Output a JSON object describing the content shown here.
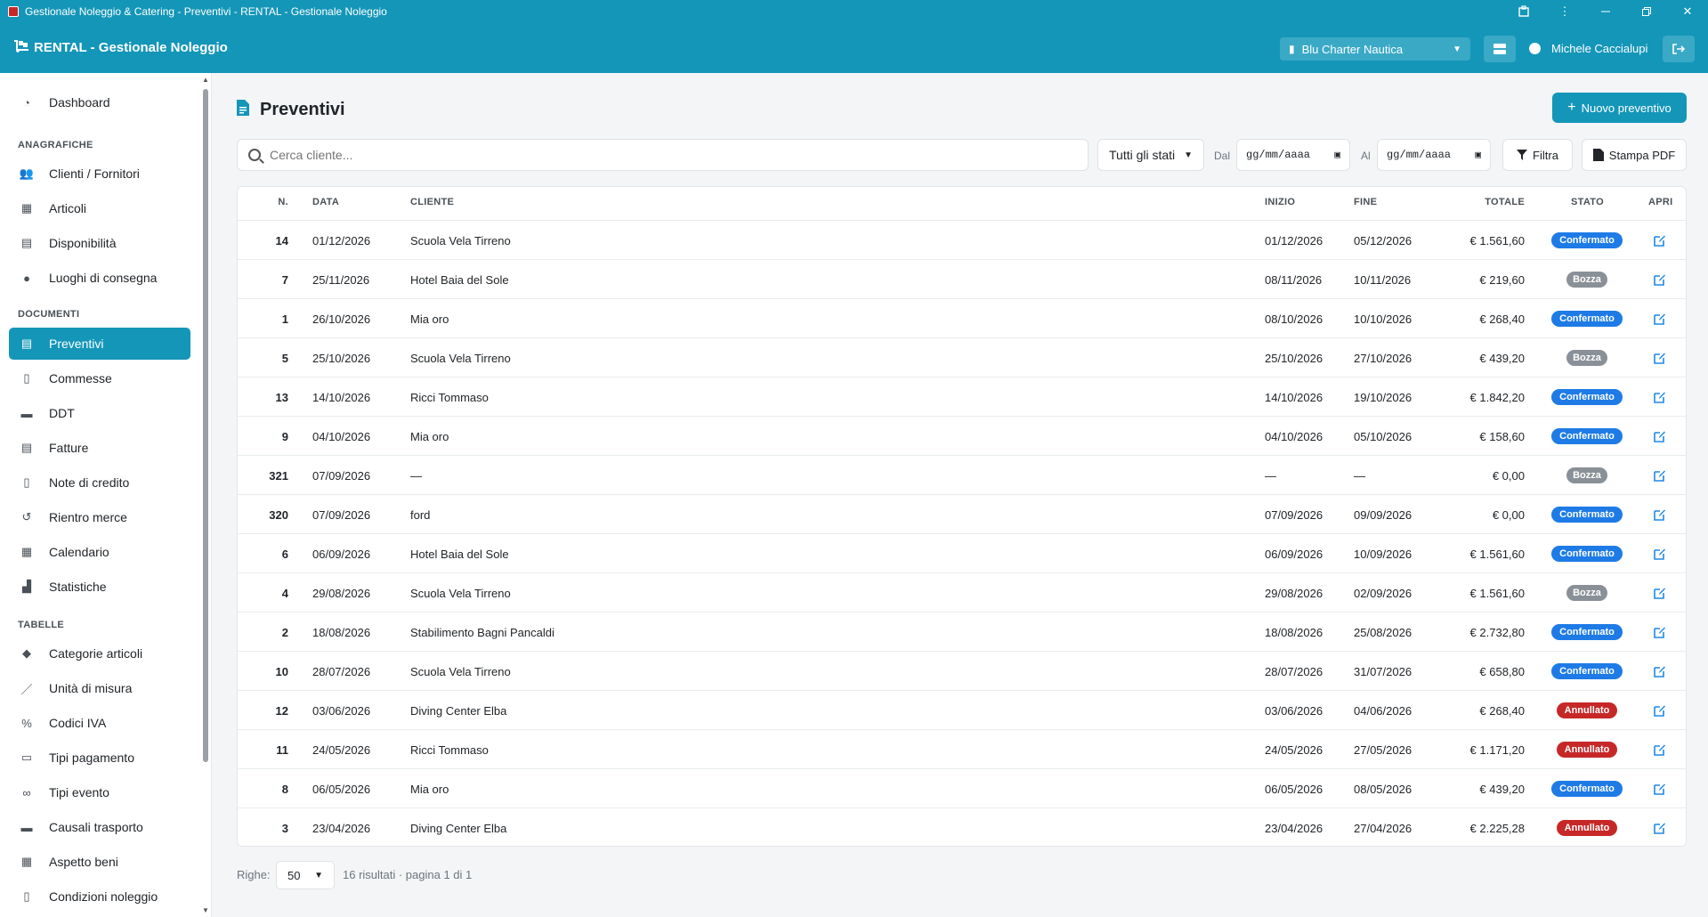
{
  "window": {
    "title": "Gestionale Noleggio & Catering - Preventivi - RENTAL - Gestionale Noleggio"
  },
  "header": {
    "brand": "RENTAL - Gestionale Noleggio",
    "company": "Blu Charter Nautica",
    "user": "Michele Caccialupi"
  },
  "sidebar": {
    "dashboard": "Dashboard",
    "sections": {
      "anagrafiche": "ANAGRAFICHE",
      "documenti": "DOCUMENTI",
      "tabelle": "TABELLE"
    },
    "items": [
      {
        "label": "Clienti / Fornitori",
        "icon": "users-icon"
      },
      {
        "label": "Articoli",
        "icon": "boxes-icon"
      },
      {
        "label": "Disponibilità",
        "icon": "warehouse-icon"
      },
      {
        "label": "Luoghi di consegna",
        "icon": "map-pin-icon"
      },
      {
        "label": "Preventivi",
        "icon": "file-invoice-icon",
        "active": true
      },
      {
        "label": "Commesse",
        "icon": "file-icon"
      },
      {
        "label": "DDT",
        "icon": "truck-icon"
      },
      {
        "label": "Fatture",
        "icon": "receipt-icon"
      },
      {
        "label": "Note di credito",
        "icon": "file-minus-icon"
      },
      {
        "label": "Rientro merce",
        "icon": "undo-icon"
      },
      {
        "label": "Calendario",
        "icon": "calendar-icon"
      },
      {
        "label": "Statistiche",
        "icon": "chart-icon"
      },
      {
        "label": "Categorie articoli",
        "icon": "tags-icon"
      },
      {
        "label": "Unità di misura",
        "icon": "ruler-icon"
      },
      {
        "label": "Codici IVA",
        "icon": "percent-icon"
      },
      {
        "label": "Tipi pagamento",
        "icon": "credit-card-icon"
      },
      {
        "label": "Tipi evento",
        "icon": "glasses-icon"
      },
      {
        "label": "Causali trasporto",
        "icon": "truck-loading-icon"
      },
      {
        "label": "Aspetto beni",
        "icon": "boxes-icon"
      },
      {
        "label": "Condizioni noleggio",
        "icon": "file-contract-icon"
      }
    ]
  },
  "page": {
    "title": "Preventivi",
    "new_button": "Nuovo preventivo"
  },
  "filters": {
    "search_placeholder": "Cerca cliente...",
    "status_value": "Tutti gli stati",
    "from_label": "Dal",
    "to_label": "Al",
    "from_placeholder": "gg/mm/aaaa",
    "to_placeholder": "gg/mm/aaaa",
    "filter_button": "Filtra",
    "print_button": "Stampa PDF"
  },
  "table": {
    "headers": {
      "n": "N.",
      "data": "DATA",
      "cliente": "CLIENTE",
      "inizio": "INIZIO",
      "fine": "FINE",
      "totale": "TOTALE",
      "stato": "STATO",
      "apri": "APRI"
    },
    "rows": [
      {
        "n": "14",
        "data": "01/12/2026",
        "cliente": "Scuola Vela Tirreno",
        "inizio": "01/12/2026",
        "fine": "05/12/2026",
        "totale": "€ 1.561,60",
        "stato": "Confermato"
      },
      {
        "n": "7",
        "data": "25/11/2026",
        "cliente": "Hotel Baia del Sole",
        "inizio": "08/11/2026",
        "fine": "10/11/2026",
        "totale": "€ 219,60",
        "stato": "Bozza"
      },
      {
        "n": "1",
        "data": "26/10/2026",
        "cliente": "Mia oro",
        "inizio": "08/10/2026",
        "fine": "10/10/2026",
        "totale": "€ 268,40",
        "stato": "Confermato"
      },
      {
        "n": "5",
        "data": "25/10/2026",
        "cliente": "Scuola Vela Tirreno",
        "inizio": "25/10/2026",
        "fine": "27/10/2026",
        "totale": "€ 439,20",
        "stato": "Bozza"
      },
      {
        "n": "13",
        "data": "14/10/2026",
        "cliente": "Ricci Tommaso",
        "inizio": "14/10/2026",
        "fine": "19/10/2026",
        "totale": "€ 1.842,20",
        "stato": "Confermato"
      },
      {
        "n": "9",
        "data": "04/10/2026",
        "cliente": "Mia oro",
        "inizio": "04/10/2026",
        "fine": "05/10/2026",
        "totale": "€ 158,60",
        "stato": "Confermato"
      },
      {
        "n": "321",
        "data": "07/09/2026",
        "cliente": "—",
        "inizio": "—",
        "fine": "—",
        "totale": "€ 0,00",
        "stato": "Bozza"
      },
      {
        "n": "320",
        "data": "07/09/2026",
        "cliente": "ford",
        "inizio": "07/09/2026",
        "fine": "09/09/2026",
        "totale": "€ 0,00",
        "stato": "Confermato"
      },
      {
        "n": "6",
        "data": "06/09/2026",
        "cliente": "Hotel Baia del Sole",
        "inizio": "06/09/2026",
        "fine": "10/09/2026",
        "totale": "€ 1.561,60",
        "stato": "Confermato"
      },
      {
        "n": "4",
        "data": "29/08/2026",
        "cliente": "Scuola Vela Tirreno",
        "inizio": "29/08/2026",
        "fine": "02/09/2026",
        "totale": "€ 1.561,60",
        "stato": "Bozza"
      },
      {
        "n": "2",
        "data": "18/08/2026",
        "cliente": "Stabilimento Bagni Pancaldi",
        "inizio": "18/08/2026",
        "fine": "25/08/2026",
        "totale": "€ 2.732,80",
        "stato": "Confermato"
      },
      {
        "n": "10",
        "data": "28/07/2026",
        "cliente": "Scuola Vela Tirreno",
        "inizio": "28/07/2026",
        "fine": "31/07/2026",
        "totale": "€ 658,80",
        "stato": "Confermato"
      },
      {
        "n": "12",
        "data": "03/06/2026",
        "cliente": "Diving Center Elba",
        "inizio": "03/06/2026",
        "fine": "04/06/2026",
        "totale": "€ 268,40",
        "stato": "Annullato"
      },
      {
        "n": "11",
        "data": "24/05/2026",
        "cliente": "Ricci Tommaso",
        "inizio": "24/05/2026",
        "fine": "27/05/2026",
        "totale": "€ 1.171,20",
        "stato": "Annullato"
      },
      {
        "n": "8",
        "data": "06/05/2026",
        "cliente": "Mia oro",
        "inizio": "06/05/2026",
        "fine": "08/05/2026",
        "totale": "€ 439,20",
        "stato": "Confermato"
      },
      {
        "n": "3",
        "data": "23/04/2026",
        "cliente": "Diving Center Elba",
        "inizio": "23/04/2026",
        "fine": "27/04/2026",
        "totale": "€ 2.225,28",
        "stato": "Annullato"
      }
    ]
  },
  "footer": {
    "rows_label": "Righe:",
    "rows_value": "50",
    "info": "16 risultati · pagina 1 di 1"
  },
  "colors": {
    "primary": "#1496b8",
    "confermato": "#1e7be6",
    "bozza": "#8a9097",
    "annullato": "#c62828"
  }
}
